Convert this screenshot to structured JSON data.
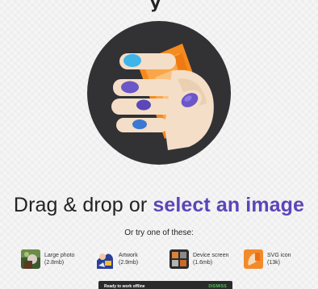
{
  "header": {
    "fragment": "y"
  },
  "hero": {
    "alt": "hand holding an image"
  },
  "main": {
    "headline_prefix": "Drag & drop or ",
    "headline_link": "select an image",
    "try_text": "Or try one of these:"
  },
  "examples": [
    {
      "title": "Large photo",
      "size": "(2.8mb)",
      "icon": "photo-thumbnail"
    },
    {
      "title": "Artwork",
      "size": "(2.9mb)",
      "icon": "artwork-thumbnail"
    },
    {
      "title": "Device screen",
      "size": "(1.6mb)",
      "icon": "device-thumbnail"
    },
    {
      "title": "SVG icon",
      "size": "(13k)",
      "icon": "svg-thumbnail"
    }
  ],
  "toast": {
    "message": "Ready to work offline",
    "action": "DISMISS"
  },
  "colors": {
    "accent": "#5b45b8",
    "toast_action": "#58c15e",
    "hero_bg": "#323235",
    "paper": "#f58a1f"
  }
}
